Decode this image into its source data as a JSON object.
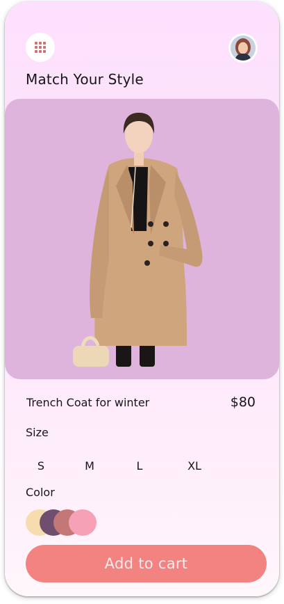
{
  "header": {
    "menu_icon": "grid-menu-icon",
    "avatar": "profile-avatar",
    "title": "Match Your Style"
  },
  "product": {
    "name": "Trench Coat for winter",
    "price": "$80"
  },
  "size": {
    "label": "Size",
    "options": [
      "S",
      "M",
      "L",
      "XL"
    ]
  },
  "color": {
    "label": "Color",
    "options": [
      "#f7dcad",
      "#6f4f6f",
      "#c47777",
      "#f6a1b5"
    ]
  },
  "actions": {
    "add_to_cart": "Add to cart"
  },
  "theme": {
    "background": "#fde0fd",
    "hero_background": "#deb3dc",
    "accent": "#f28381",
    "icon_color": "#d36f6f"
  }
}
